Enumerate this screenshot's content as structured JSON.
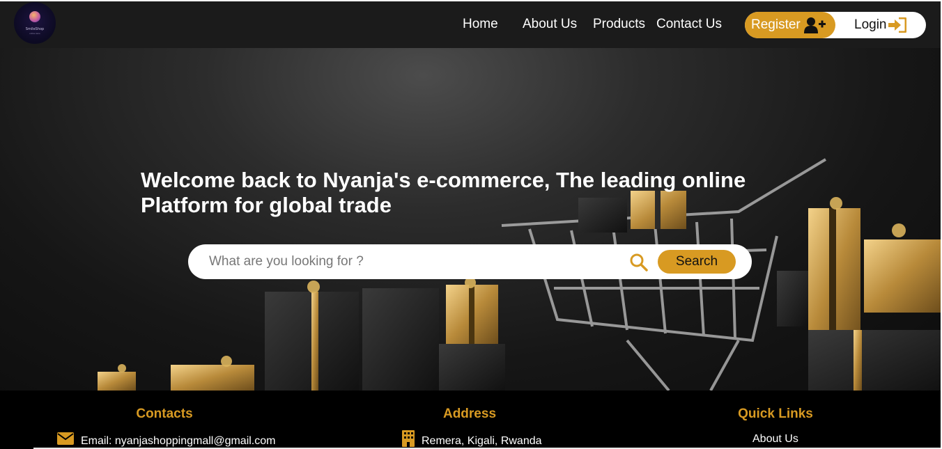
{
  "brand": {
    "logo_text": "SmileShop",
    "logo_subtext": "online store"
  },
  "nav": {
    "home": "Home",
    "about": "About Us",
    "products": "Products",
    "contact": "Contact Us",
    "register": "Register",
    "login": "Login"
  },
  "hero": {
    "title": "Welcome back to Nyanja's e-commerce, The leading online Platform for global trade",
    "search_placeholder": "What are you looking for ?",
    "search_button": "Search"
  },
  "footer": {
    "contacts_title": "Contacts",
    "address_title": "Address",
    "quick_links_title": "Quick Links",
    "email": "Email: nyanjashoppingmall@gmail.com",
    "address": "Remera, Kigali, Rwanda",
    "quick_links": [
      "About Us"
    ]
  },
  "colors": {
    "accent": "#d89a22",
    "navbar": "#1b1b1b",
    "footer": "#000000"
  },
  "icons": {
    "register": "user-plus-icon",
    "login": "sign-in-icon",
    "search": "search-icon",
    "email": "envelope-icon",
    "address": "building-icon"
  }
}
